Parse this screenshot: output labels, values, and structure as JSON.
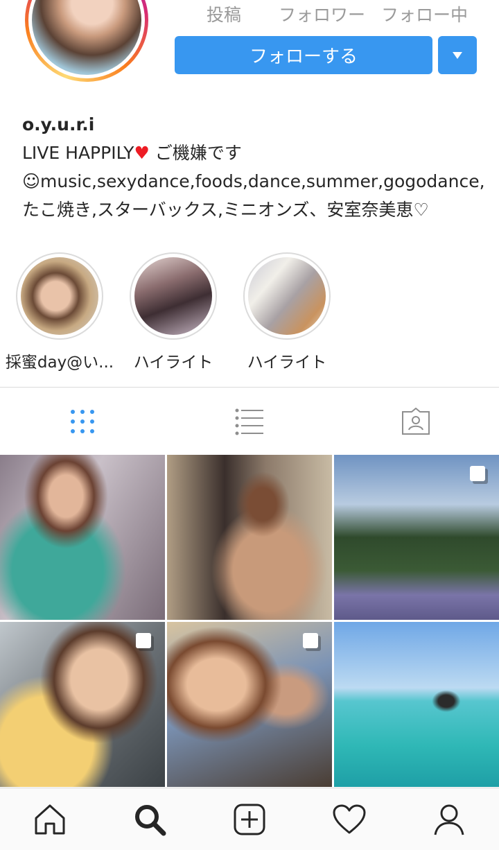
{
  "header": {
    "stats": {
      "posts_label": "投稿",
      "followers_label": "フォロワー",
      "following_label": "フォロー中"
    },
    "follow_button": "フォローする"
  },
  "profile": {
    "username": "o.y.u.r.i",
    "bio": {
      "line1_text": "LIVE HAPPILY",
      "line1_emoji": "♥",
      "line1_after": " ご機嫌です",
      "line2": "☺music,sexydance,foods,dance,summer,gogodance,",
      "line3": "たこ焼き,スターバックス,ミニオンズ、安室奈美恵♡"
    }
  },
  "highlights": [
    {
      "label": "採蜜day@い..."
    },
    {
      "label": "ハイライト"
    },
    {
      "label": "ハイライト"
    }
  ],
  "tabs": [
    "grid-icon",
    "list-icon",
    "tagged-icon"
  ],
  "bottom_nav": [
    "home-icon",
    "search-icon",
    "new-post-icon",
    "activity-heart-icon",
    "profile-icon"
  ],
  "colors": {
    "accent": "#3897f0",
    "grid_active": "#3897f0",
    "icon_inactive": "#8e8e8e"
  }
}
